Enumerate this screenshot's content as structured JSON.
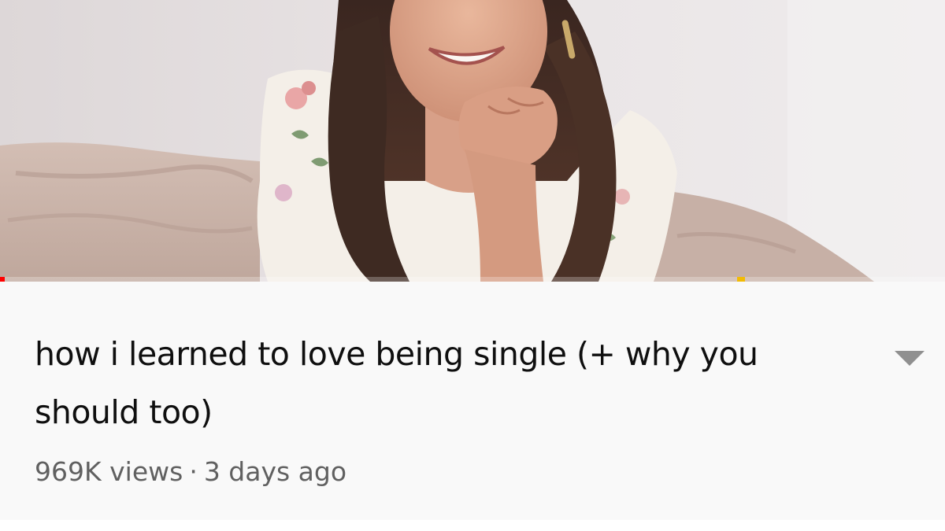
{
  "video": {
    "title": "how i learned to love being single (+ why you should too)",
    "views": "969K views",
    "separator": "·",
    "uploaded": "3 days ago",
    "playback_progress": 0.005
  },
  "colors": {
    "progress_played": "#ff0000",
    "ad_marker": "#f2bb05",
    "title_text": "#0f0f0f",
    "meta_text": "#606060",
    "panel_background": "#f9f9f9"
  },
  "icons": {
    "expand": "chevron-down-icon"
  }
}
